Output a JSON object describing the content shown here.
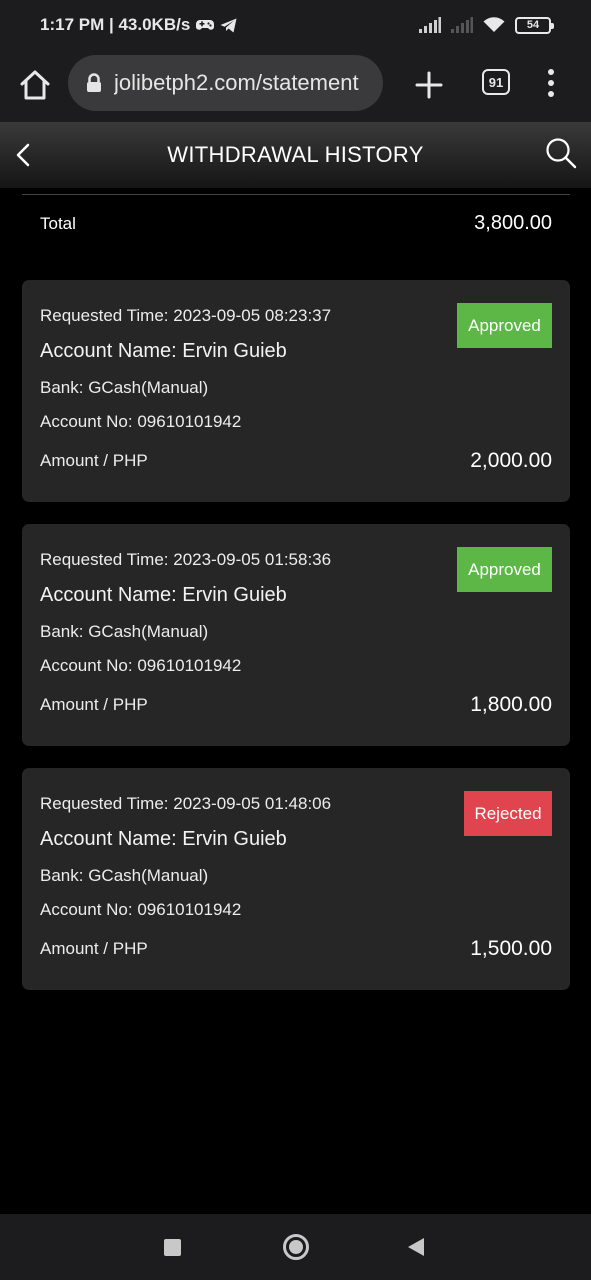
{
  "status_bar": {
    "time_speed": "1:17 PM | 43.0KB/s",
    "battery": "54",
    "icons": [
      "gamepad-icon",
      "telegram-icon",
      "signal-icon",
      "signal-off-icon",
      "wifi-icon",
      "battery-icon"
    ]
  },
  "browser": {
    "url": "jolibetph2.com/statement",
    "tab_count": "91"
  },
  "header": {
    "title": "WITHDRAWAL HISTORY"
  },
  "total": {
    "label": "Total",
    "value": "3,800.00"
  },
  "records": [
    {
      "requested_time": "Requested Time: 2023-09-05 08:23:37",
      "account_name": "Account Name: Ervin Guieb",
      "bank": "Bank: GCash(Manual)",
      "account_no": "Account No: 09610101942",
      "amount_label": "Amount / PHP",
      "amount": "2,000.00",
      "status": "Approved"
    },
    {
      "requested_time": "Requested Time: 2023-09-05 01:58:36",
      "account_name": "Account Name: Ervin Guieb",
      "bank": "Bank: GCash(Manual)",
      "account_no": "Account No: 09610101942",
      "amount_label": "Amount / PHP",
      "amount": "1,800.00",
      "status": "Approved"
    },
    {
      "requested_time": "Requested Time: 2023-09-05 01:48:06",
      "account_name": "Account Name: Ervin Guieb",
      "bank": "Bank: GCash(Manual)",
      "account_no": "Account No: 09610101942",
      "amount_label": "Amount / PHP",
      "amount": "1,500.00",
      "status": "Rejected"
    }
  ],
  "colors": {
    "approved": "#5cb746",
    "rejected": "#e0444f",
    "card_bg": "#262626"
  }
}
